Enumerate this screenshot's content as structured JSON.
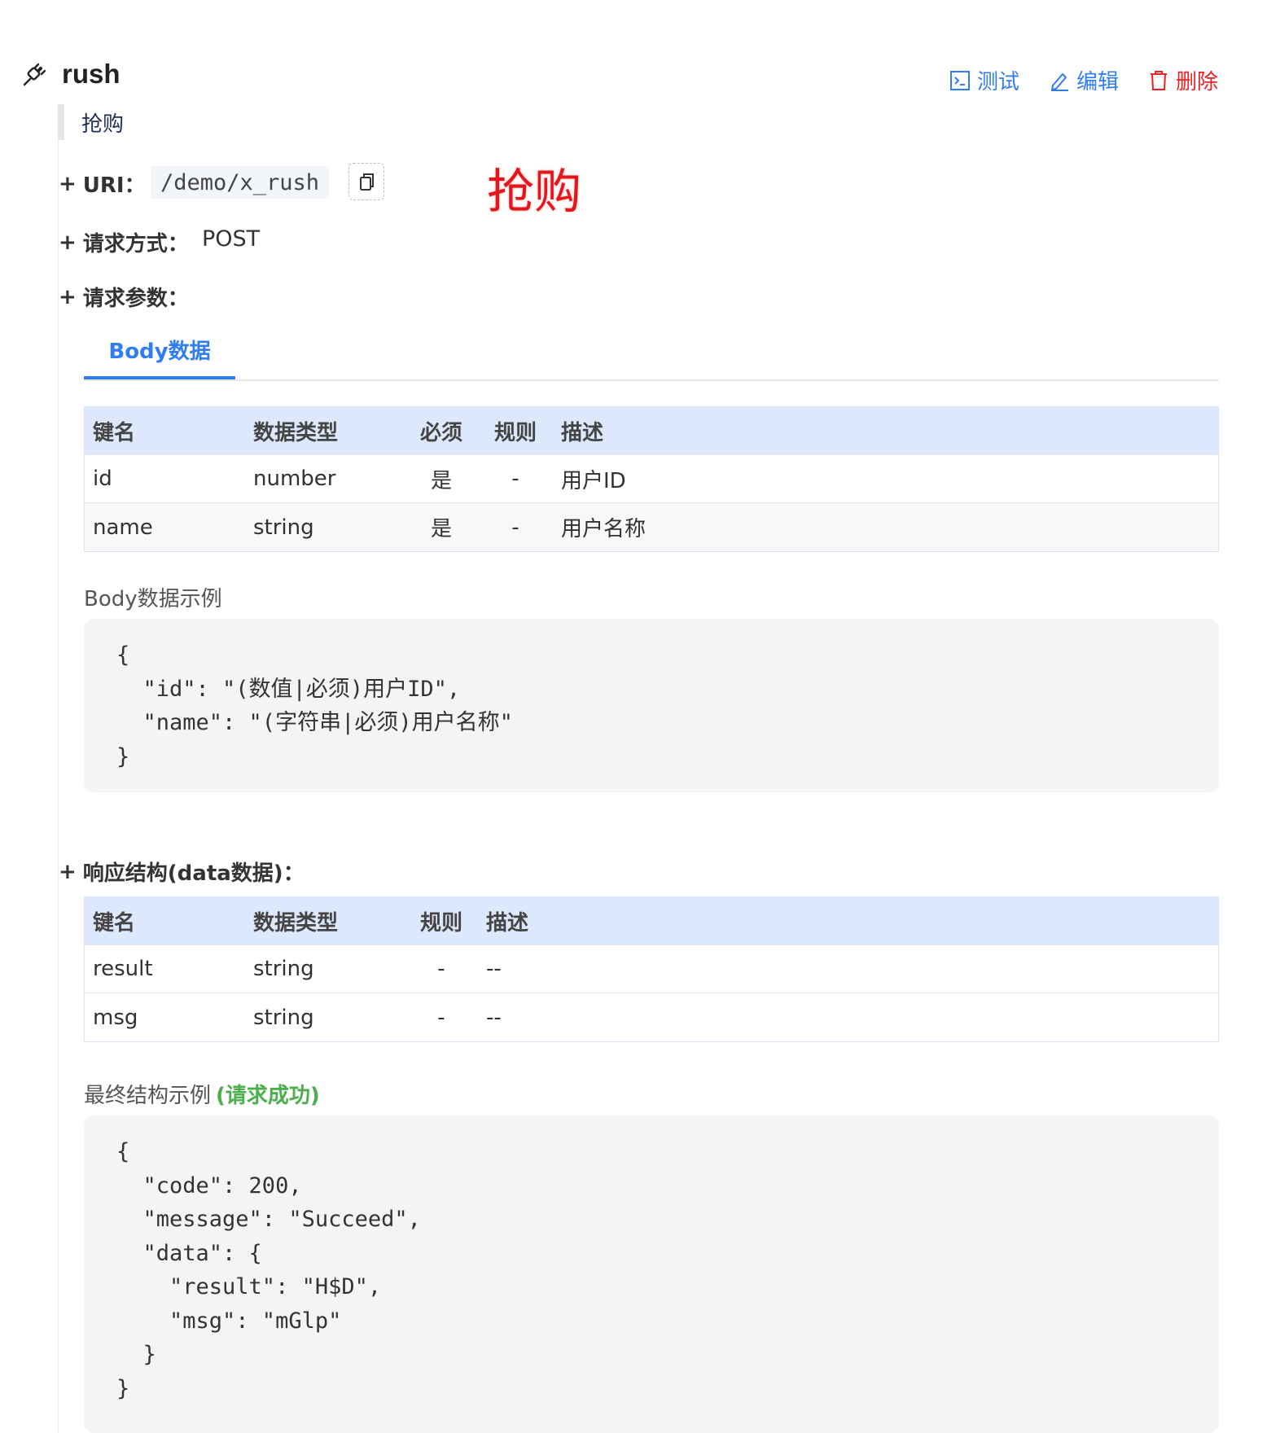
{
  "api": {
    "name": "rush",
    "description": "抢购",
    "stamp": "抢购"
  },
  "actions": {
    "test": "测试",
    "edit": "编辑",
    "delete": "删除"
  },
  "uri": {
    "label": "URI：",
    "value": "/demo/x_rush"
  },
  "method": {
    "label": "请求方式：",
    "value": "POST"
  },
  "params": {
    "label": "请求参数：",
    "tab": "Body数据",
    "columns": [
      "键名",
      "数据类型",
      "必须",
      "规则",
      "描述"
    ],
    "rows": [
      {
        "name": "id",
        "type": "number",
        "required": "是",
        "rule": "-",
        "desc": "用户ID"
      },
      {
        "name": "name",
        "type": "string",
        "required": "是",
        "rule": "-",
        "desc": "用户名称"
      }
    ],
    "example_title": "Body数据示例",
    "example": "{\n  \"id\": \"(数值|必须)用户ID\",\n  \"name\": \"(字符串|必须)用户名称\"\n}"
  },
  "response": {
    "label": "响应结构(data数据)：",
    "columns": [
      "键名",
      "数据类型",
      "规则",
      "描述"
    ],
    "rows": [
      {
        "name": "result",
        "type": "string",
        "rule": "-",
        "desc": "--"
      },
      {
        "name": "msg",
        "type": "string",
        "rule": "-",
        "desc": "--"
      }
    ],
    "example_title": "最终结构示例",
    "example_status": "(请求成功)",
    "example": "{\n  \"code\": 200,\n  \"message\": \"Succeed\",\n  \"data\": {\n    \"result\": \"H$D\",\n    \"msg\": \"mGlp\"\n  }\n}"
  },
  "plus": "+",
  "colors": {
    "accent": "#2f7df3",
    "danger": "#ee2222",
    "success": "#4cae4c",
    "table_header": "#dde8fc"
  }
}
